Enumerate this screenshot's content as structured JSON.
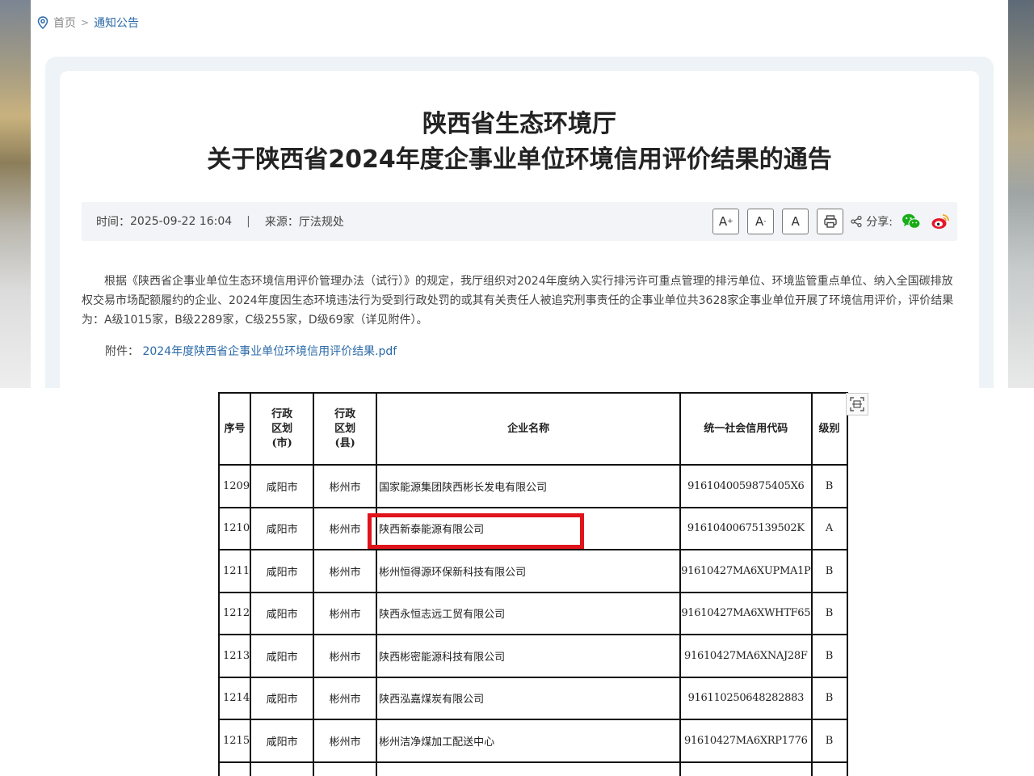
{
  "breadcrumb": {
    "home": "首页",
    "separator": ">",
    "current": "通知公告"
  },
  "article": {
    "title_line1": "陕西省生态环境厅",
    "title_line2": "关于陕西省2024年度企事业单位环境信用评价结果的通告",
    "time_label": "时间：",
    "time_value": "2025-09-22 16:04",
    "divider": "|",
    "source_label": "来源：",
    "source_value": "厅法规处",
    "font_large": "A",
    "font_small": "A",
    "font_normal": "A",
    "share_label": "分享:",
    "paragraph": "根据《陕西省企事业单位生态环境信用评价管理办法（试行）》的规定，我厅组织对2024年度纳入实行排污许可重点管理的排污单位、环境监管重点单位、纳入全国碳排放权交易市场配额履约的企业、2024年度因生态环境违法行为受到行政处罚的或其有关责任人被追究刑事责任的企事业单位共3628家企事业单位开展了环境信用评价，评价结果为：A级1015家，B级2289家，C级255家，D级69家（详见附件）。",
    "attachment_label": "附件：",
    "attachment_link": "2024年度陕西省企事业单位环境信用评价结果.pdf"
  },
  "table": {
    "headers": {
      "seq": "序号",
      "city_l1": "行政",
      "city_l2": "区划",
      "city_l3": "(市)",
      "county_l1": "行政",
      "county_l2": "区划",
      "county_l3": "(县)",
      "name": "企业名称",
      "code": "统一社会信用代码",
      "grade": "级别"
    },
    "rows": [
      {
        "seq": "1209",
        "city": "咸阳市",
        "county": "彬州市",
        "name": "国家能源集团陕西彬长发电有限公司",
        "code": "9161040059875405X6",
        "grade": "B"
      },
      {
        "seq": "1210",
        "city": "咸阳市",
        "county": "彬州市",
        "name": "陕西新泰能源有限公司",
        "code": "91610400675139502K",
        "grade": "A"
      },
      {
        "seq": "1211",
        "city": "咸阳市",
        "county": "彬州市",
        "name": "彬州恒得源环保新科技有限公司",
        "code": "91610427MA6XUPMA1P",
        "grade": "B"
      },
      {
        "seq": "1212",
        "city": "咸阳市",
        "county": "彬州市",
        "name": "陕西永恒志远工贸有限公司",
        "code": "91610427MA6XWHTF65",
        "grade": "B"
      },
      {
        "seq": "1213",
        "city": "咸阳市",
        "county": "彬州市",
        "name": "陕西彬密能源科技有限公司",
        "code": "91610427MA6XNAJ28F",
        "grade": "B"
      },
      {
        "seq": "1214",
        "city": "咸阳市",
        "county": "彬州市",
        "name": "陕西泓嘉煤炭有限公司",
        "code": "916110250648282883",
        "grade": "B"
      },
      {
        "seq": "1215",
        "city": "咸阳市",
        "county": "彬州市",
        "name": "彬州洁净煤加工配送中心",
        "code": "91610427MA6XRP1776",
        "grade": "B"
      }
    ]
  },
  "colors": {
    "highlight": "#e0141b",
    "link": "#2b6aa8",
    "meta_bg": "#f2f4f7"
  }
}
